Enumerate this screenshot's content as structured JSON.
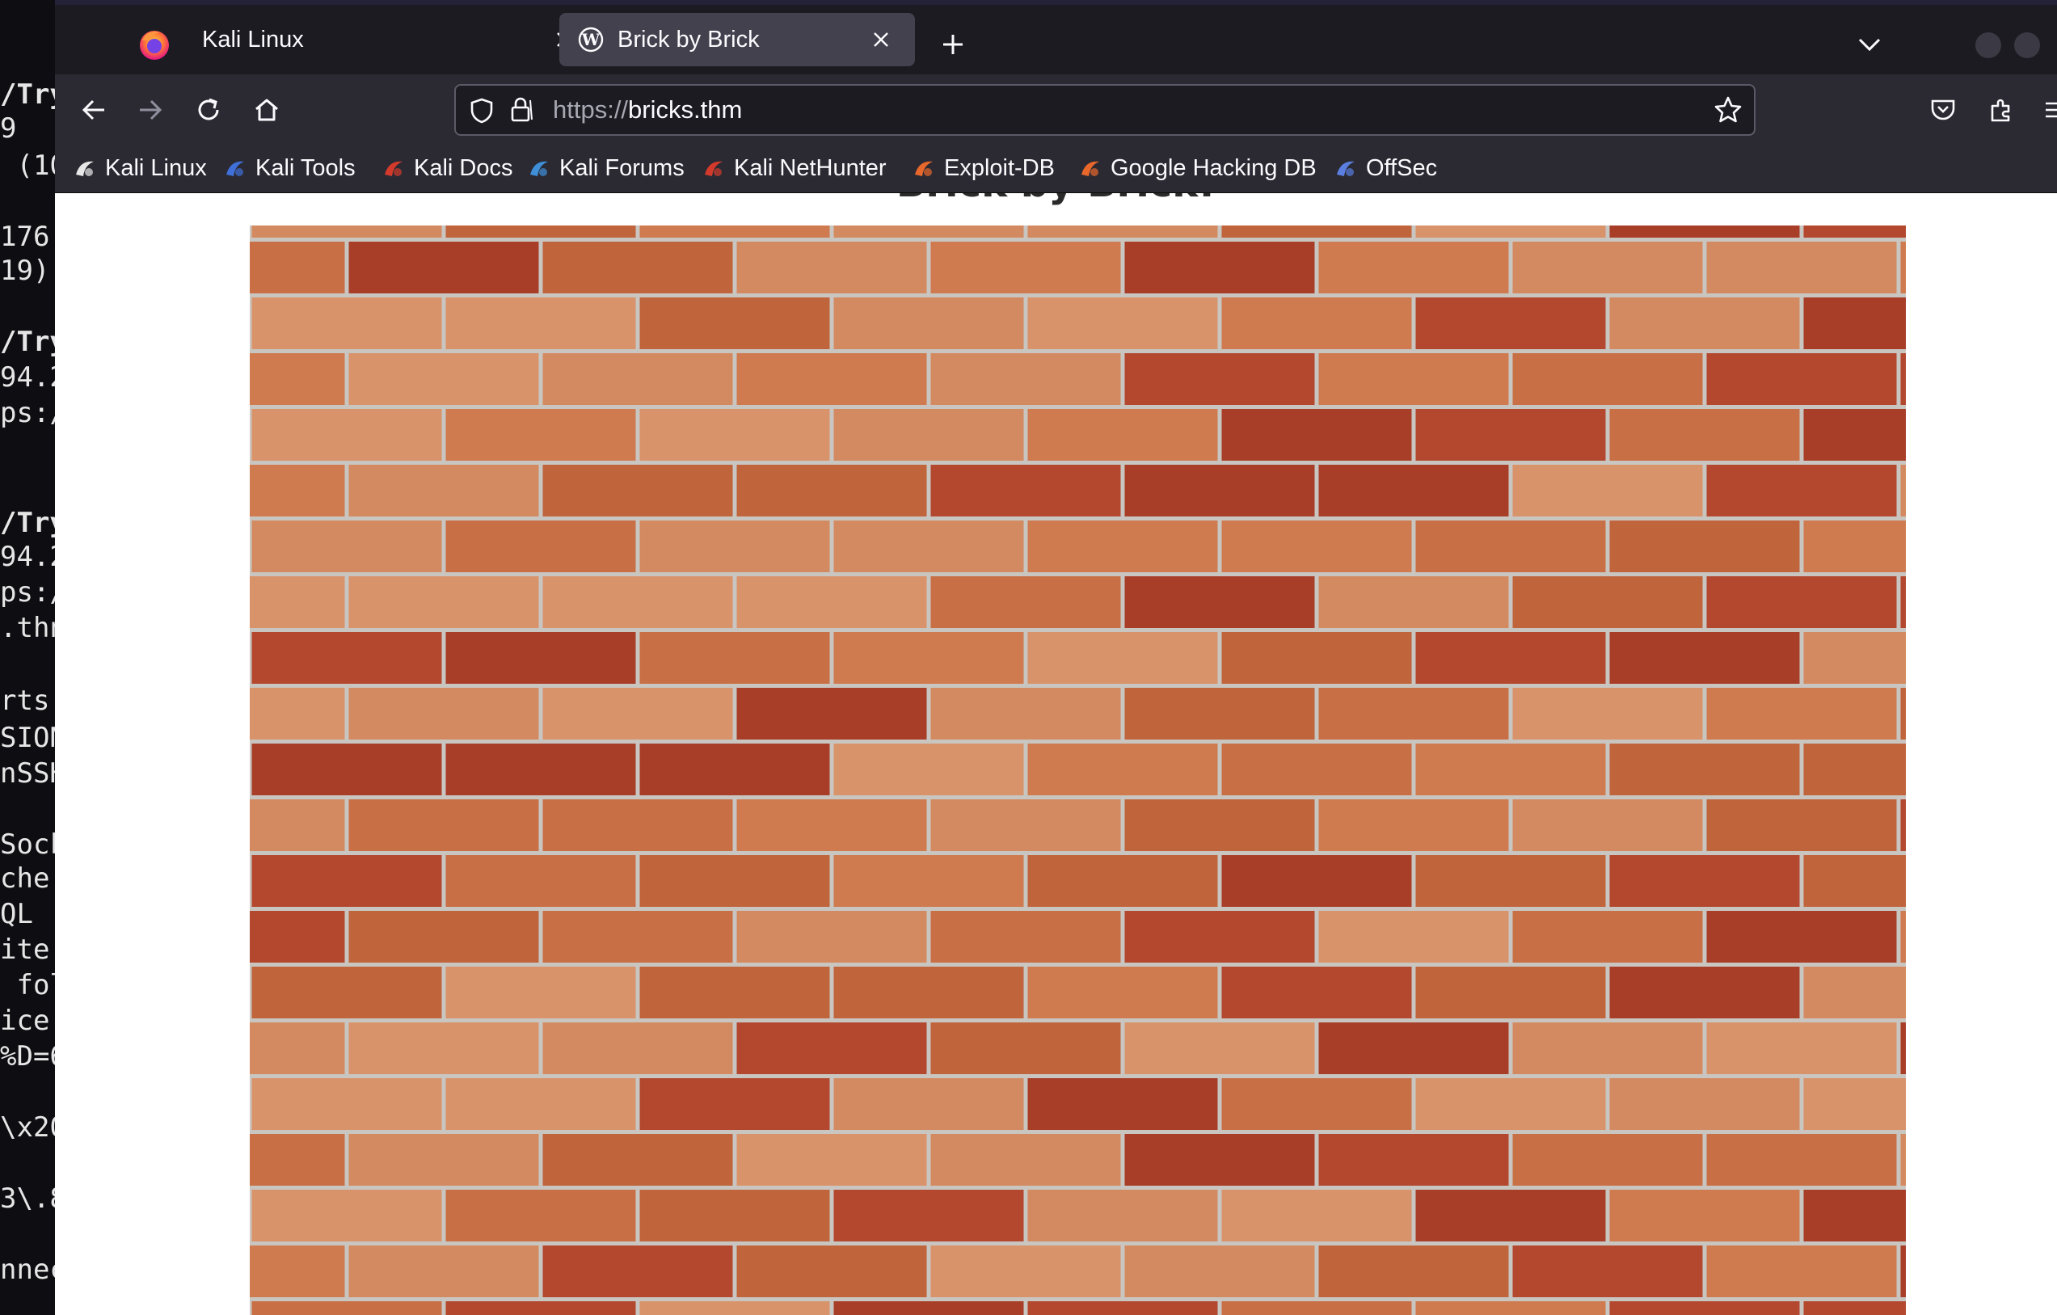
{
  "terminal": {
    "lines": [
      {
        "text": "/Try",
        "bold": true
      },
      {
        "text": "9",
        "bold": false
      },
      {
        "text": " (10",
        "bold": false
      },
      {
        "text": "176.",
        "bold": false
      },
      {
        "text": "19)",
        "bold": false
      },
      {
        "text": "/Try",
        "bold": true
      },
      {
        "text": "94.2",
        "bold": false
      },
      {
        "text": "ps:/",
        "bold": false
      },
      {
        "text": "/Try",
        "bold": true
      },
      {
        "text": "94.2",
        "bold": false
      },
      {
        "text": "ps:/",
        "bold": false
      },
      {
        "text": ".thn",
        "bold": false
      },
      {
        "text": "rts",
        "bold": false
      },
      {
        "text": "SION",
        "bold": false
      },
      {
        "text": "nSSH",
        "bold": false
      },
      {
        "text": "Sock",
        "bold": false
      },
      {
        "text": "che",
        "bold": false
      },
      {
        "text": "QL (",
        "bold": false
      },
      {
        "text": "ite",
        "bold": false
      },
      {
        "text": " fol",
        "bold": false
      },
      {
        "text": "ice",
        "bold": false
      },
      {
        "text": "%D=6",
        "bold": false
      },
      {
        "text": "\\x20",
        "bold": false
      },
      {
        "text": "3\\.8",
        "bold": false
      },
      {
        "text": "nnec",
        "bold": false
      }
    ]
  },
  "browser": {
    "tabs": [
      {
        "title": "Kali Linux",
        "active": false,
        "close_symbol": "×",
        "icon": "close-icon"
      },
      {
        "title": "Brick by Brick",
        "active": true,
        "close_symbol": "×",
        "icon": "wordpress-icon"
      }
    ],
    "new_tab_symbol": "+",
    "url": {
      "scheme": "https://",
      "host": "bricks.thm"
    },
    "bookmarks": [
      {
        "label": "Kali Linux",
        "icon": "kali-dragon-icon",
        "color": "#e8e8e8"
      },
      {
        "label": "Kali Tools",
        "icon": "kali-tools-icon",
        "color": "#3f6fd8"
      },
      {
        "label": "Kali Docs",
        "icon": "kali-docs-icon",
        "color": "#d33a2c"
      },
      {
        "label": "Kali Forums",
        "icon": "kali-forums-icon",
        "color": "#3f8ed8"
      },
      {
        "label": "Kali NetHunter",
        "icon": "nethunter-icon",
        "color": "#d33a2c"
      },
      {
        "label": "Exploit-DB",
        "icon": "exploit-db-icon",
        "color": "#e8672b"
      },
      {
        "label": "Google Hacking DB",
        "icon": "ghdb-icon",
        "color": "#e8672b"
      },
      {
        "label": "OffSec",
        "icon": "offsec-icon",
        "color": "#5a7fe0"
      }
    ]
  },
  "page": {
    "heading": "Brick by Brick!",
    "wall": {
      "mortar": "#c9c5c0",
      "brick_colors": [
        "#c0643c",
        "#cf7a4f",
        "#b3482f",
        "#d48a60",
        "#a83e28",
        "#c96f45",
        "#d9936a"
      ]
    }
  }
}
